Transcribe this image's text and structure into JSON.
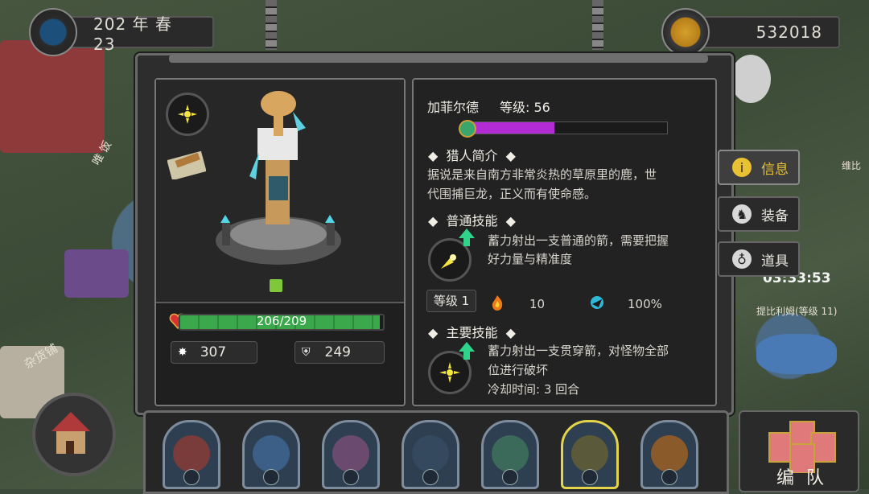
{
  "header": {
    "date": "202 年 春 23",
    "coins": "532018"
  },
  "world": {
    "timer": "03:33:53",
    "enemy_label": "提比利姆(等级 11)",
    "shop_label": "杂货铺",
    "sign_label_1": "唯 饭",
    "side_label": "维比"
  },
  "hero": {
    "name": "加菲尔德",
    "level_text": "等级: 56",
    "xp_fraction": 0.44,
    "hp_current": 206,
    "hp_max": 209,
    "hp_text": "206/209",
    "attack": "307",
    "defense": "249"
  },
  "sections": {
    "profile_title": "猎人简介",
    "profile_text_1": "据说是来自南方非常炎热的草原里的鹿，世",
    "profile_text_2": "代围捕巨龙，正义而有使命感。",
    "normal_skill_title": "普通技能",
    "normal_skill_desc_1": "蓄力射出一支普通的箭，需要把握",
    "normal_skill_desc_2": "好力量与精准度",
    "normal_skill_level": "等级 1",
    "normal_skill_fire": "10",
    "normal_skill_crit": "100%",
    "main_skill_title": "主要技能",
    "main_skill_desc_1": "蓄力射出一支贯穿箭，对怪物全部",
    "main_skill_desc_2": "位进行破坏",
    "main_skill_cooldown": "冷却时间: 3 回合"
  },
  "tabs": [
    {
      "label": "信息",
      "icon": "info-icon",
      "active": true
    },
    {
      "label": "装备",
      "icon": "helmet-icon",
      "active": false
    },
    {
      "label": "道具",
      "icon": "bag-icon",
      "active": false
    }
  ],
  "roster": [
    {
      "icon": "pirate-boar-portrait",
      "bg": "#7a3b3b"
    },
    {
      "icon": "eagle-portrait",
      "bg": "#3b5f86"
    },
    {
      "icon": "sheep-portrait",
      "bg": "#6a4a6e"
    },
    {
      "icon": "polar-bear-portrait",
      "bg": "#34495e"
    },
    {
      "icon": "crocodile-portrait",
      "bg": "#3c6a5a"
    },
    {
      "icon": "giraffe-portrait",
      "bg": "#5a5a3a",
      "selected": true
    },
    {
      "icon": "leopard-portrait",
      "bg": "#8a5a2a"
    }
  ],
  "team_label": "编 队",
  "colors": {
    "xp_fill": "#b22bd4",
    "hp_fill": "#3ba84b",
    "selected_border": "#e3d44b",
    "info_icon": "#e8c233"
  }
}
